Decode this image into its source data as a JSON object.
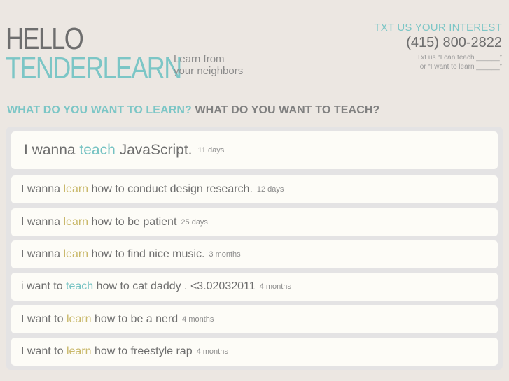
{
  "header": {
    "logo_line1": "HELLO",
    "logo_line2": "TENDERLEARN",
    "tagline_line1": "Learn from",
    "tagline_line2": "your neighbors"
  },
  "contact": {
    "cta": "TXT US YOUR INTEREST",
    "phone": "(415) 800-2822",
    "hint_line1": "Txt us “I can teach ______”",
    "hint_line2": "or “I want to learn ______”"
  },
  "headline": {
    "learn": "WHAT DO YOU WANT TO LEARN?",
    "teach": "WHAT DO YOU WANT TO TEACH?"
  },
  "posts": [
    {
      "prefix": "I wanna",
      "verb": "teach",
      "rest": "JavaScript.",
      "ago": "11 days"
    },
    {
      "prefix": "I wanna",
      "verb": "learn",
      "rest": "how to conduct design research.",
      "ago": "12 days"
    },
    {
      "prefix": "I wanna",
      "verb": "learn",
      "rest": "how to be patient",
      "ago": "25 days"
    },
    {
      "prefix": "I wanna",
      "verb": "learn",
      "rest": "how to find nice music.",
      "ago": "3 months"
    },
    {
      "prefix": "i want to",
      "verb": "teach",
      "rest": "how to cat daddy . <3.02032011",
      "ago": "4 months"
    },
    {
      "prefix": "I want to",
      "verb": "learn",
      "rest": "how to be a nerd",
      "ago": "4 months"
    },
    {
      "prefix": "I want to",
      "verb": "learn",
      "rest": "how to freestyle rap",
      "ago": "4 months"
    }
  ],
  "colors": {
    "brand_teal": "#7cc6c6",
    "learn_gold": "#c9b86a",
    "background": "#ece7e2"
  }
}
